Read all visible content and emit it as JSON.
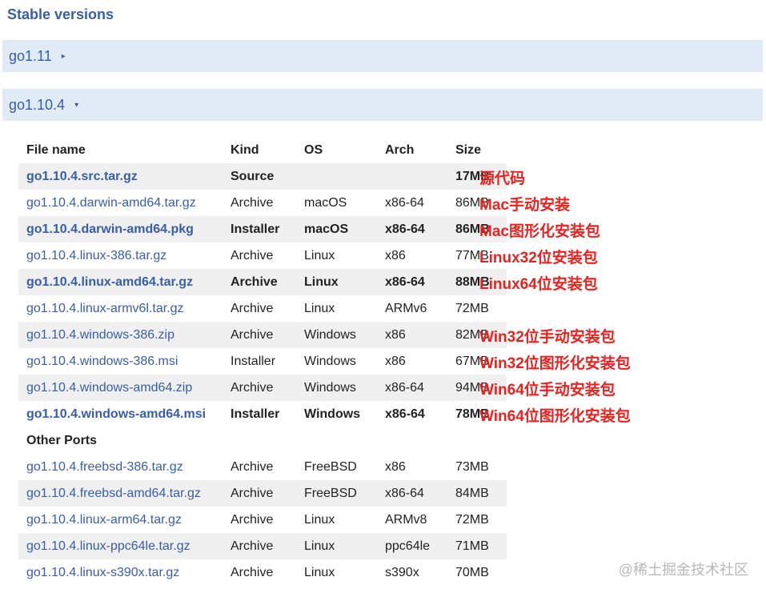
{
  "section_title": "Stable versions",
  "versions": [
    {
      "name": "go1.11",
      "toggle": "▸"
    },
    {
      "name": "go1.10.4",
      "toggle": "▾"
    }
  ],
  "table": {
    "headers": [
      "File name",
      "Kind",
      "OS",
      "Arch",
      "Size"
    ],
    "rows": [
      {
        "file": "go1.10.4.src.tar.gz",
        "kind": "Source",
        "os": "",
        "arch": "",
        "size": "17MB",
        "highlight": true,
        "odd": true
      },
      {
        "file": "go1.10.4.darwin-amd64.tar.gz",
        "kind": "Archive",
        "os": "macOS",
        "arch": "x86-64",
        "size": "86MB",
        "highlight": false,
        "odd": false
      },
      {
        "file": "go1.10.4.darwin-amd64.pkg",
        "kind": "Installer",
        "os": "macOS",
        "arch": "x86-64",
        "size": "86MB",
        "highlight": true,
        "odd": true
      },
      {
        "file": "go1.10.4.linux-386.tar.gz",
        "kind": "Archive",
        "os": "Linux",
        "arch": "x86",
        "size": "77MB",
        "highlight": false,
        "odd": false
      },
      {
        "file": "go1.10.4.linux-amd64.tar.gz",
        "kind": "Archive",
        "os": "Linux",
        "arch": "x86-64",
        "size": "88MB",
        "highlight": true,
        "odd": true
      },
      {
        "file": "go1.10.4.linux-armv6l.tar.gz",
        "kind": "Archive",
        "os": "Linux",
        "arch": "ARMv6",
        "size": "72MB",
        "highlight": false,
        "odd": false
      },
      {
        "file": "go1.10.4.windows-386.zip",
        "kind": "Archive",
        "os": "Windows",
        "arch": "x86",
        "size": "82MB",
        "highlight": false,
        "odd": true
      },
      {
        "file": "go1.10.4.windows-386.msi",
        "kind": "Installer",
        "os": "Windows",
        "arch": "x86",
        "size": "67MB",
        "highlight": false,
        "odd": false
      },
      {
        "file": "go1.10.4.windows-amd64.zip",
        "kind": "Archive",
        "os": "Windows",
        "arch": "x86-64",
        "size": "94MB",
        "highlight": false,
        "odd": true
      },
      {
        "file": "go1.10.4.windows-amd64.msi",
        "kind": "Installer",
        "os": "Windows",
        "arch": "x86-64",
        "size": "78MB",
        "highlight": true,
        "odd": false
      }
    ],
    "other_ports_label": "Other Ports",
    "other_ports": [
      {
        "file": "go1.10.4.freebsd-386.tar.gz",
        "kind": "Archive",
        "os": "FreeBSD",
        "arch": "x86",
        "size": "73MB",
        "highlight": false,
        "odd": false
      },
      {
        "file": "go1.10.4.freebsd-amd64.tar.gz",
        "kind": "Archive",
        "os": "FreeBSD",
        "arch": "x86-64",
        "size": "84MB",
        "highlight": false,
        "odd": true
      },
      {
        "file": "go1.10.4.linux-arm64.tar.gz",
        "kind": "Archive",
        "os": "Linux",
        "arch": "ARMv8",
        "size": "72MB",
        "highlight": false,
        "odd": false
      },
      {
        "file": "go1.10.4.linux-ppc64le.tar.gz",
        "kind": "Archive",
        "os": "Linux",
        "arch": "ppc64le",
        "size": "71MB",
        "highlight": false,
        "odd": true
      },
      {
        "file": "go1.10.4.linux-s390x.tar.gz",
        "kind": "Archive",
        "os": "Linux",
        "arch": "s390x",
        "size": "70MB",
        "highlight": false,
        "odd": false
      }
    ]
  },
  "annotations": [
    {
      "row": 0,
      "text": "源代码"
    },
    {
      "row": 1,
      "text": "Mac手动安装"
    },
    {
      "row": 2,
      "text": "Mac图形化安装包"
    },
    {
      "row": 3,
      "text": "Linux32位安装包"
    },
    {
      "row": 4,
      "text": "Linux64位安装包"
    },
    {
      "row": 6,
      "text": "Win32位手动安装包"
    },
    {
      "row": 7,
      "text": "Win32位图形化安装包"
    },
    {
      "row": 8,
      "text": "Win64位手动安装包"
    },
    {
      "row": 9,
      "text": "Win64位图形化安装包"
    }
  ],
  "watermark": "@稀土掘金技术社区",
  "colors": {
    "link": "#375eab",
    "bar_bg": "#e0ebf5",
    "row_alt": "#f0f0f0",
    "annotation": "#e8231f"
  }
}
